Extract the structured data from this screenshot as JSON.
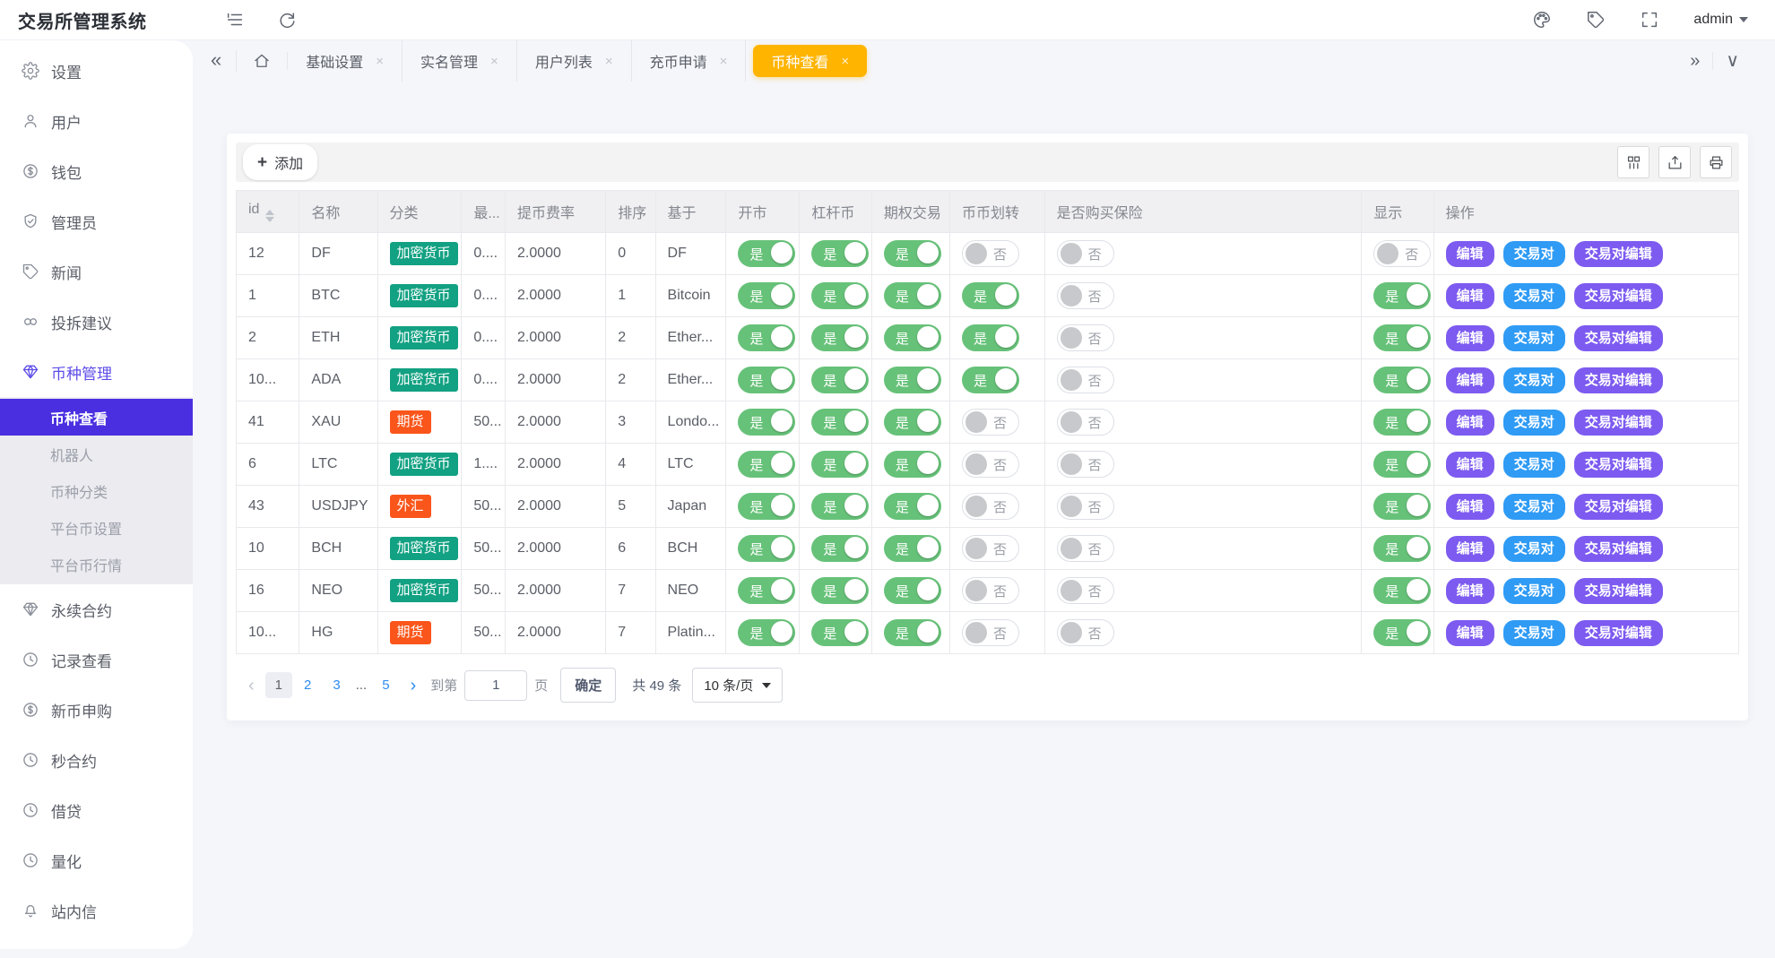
{
  "topbar": {
    "title": "交易所管理系统",
    "user": "admin"
  },
  "glyphs": {
    "double_left": "«",
    "double_right": "»",
    "chevron_down": "∨",
    "close": "×",
    "plus": "+"
  },
  "tabs": {
    "items": [
      {
        "label": "基础设置",
        "active": false
      },
      {
        "label": "实名管理",
        "active": false
      },
      {
        "label": "用户列表",
        "active": false
      },
      {
        "label": "充币申请",
        "active": false
      },
      {
        "label": "币种查看",
        "active": true
      }
    ],
    "active_color": "#ffb400"
  },
  "sidebar": {
    "items": [
      {
        "label": "设置",
        "icon": "gear"
      },
      {
        "label": "用户",
        "icon": "user"
      },
      {
        "label": "钱包",
        "icon": "coin"
      },
      {
        "label": "管理员",
        "icon": "shield"
      },
      {
        "label": "新闻",
        "icon": "tag"
      },
      {
        "label": "投拆建议",
        "icon": "link"
      },
      {
        "label": "币种管理",
        "icon": "gem",
        "active": true,
        "children": [
          {
            "label": "币种查看",
            "active": true
          },
          {
            "label": "机器人",
            "active": false
          },
          {
            "label": "币种分类",
            "active": false
          },
          {
            "label": "平台币设置",
            "active": false
          },
          {
            "label": "平台币行情",
            "active": false
          }
        ]
      },
      {
        "label": "永续合约",
        "icon": "gem"
      },
      {
        "label": "记录查看",
        "icon": "clock"
      },
      {
        "label": "新币申购",
        "icon": "coin"
      },
      {
        "label": "秒合约",
        "icon": "clock"
      },
      {
        "label": "借贷",
        "icon": "clock"
      },
      {
        "label": "量化",
        "icon": "clock"
      },
      {
        "label": "站内信",
        "icon": "bell"
      }
    ],
    "active_bg": "#4a2fe0",
    "active_text": "#5d4ce8"
  },
  "toolbar": {
    "add_label": "添加",
    "add_icon": "+"
  },
  "table": {
    "toggle_on": "是",
    "toggle_off": "否",
    "toggle_on_color": "#67c279",
    "badge_colors": {
      "teal": "#12a182",
      "orange": "#fa551a"
    },
    "columns": [
      {
        "key": "id",
        "label": "id",
        "width": 4.2,
        "sortable": true
      },
      {
        "key": "name",
        "label": "名称",
        "width": 5.2
      },
      {
        "key": "category",
        "label": "分类",
        "width": 5.6,
        "type": "badge"
      },
      {
        "key": "min",
        "label": "最...",
        "width": 2.9
      },
      {
        "key": "fee",
        "label": "提币费率",
        "width": 6.7
      },
      {
        "key": "sort",
        "label": "排序",
        "width": 3.3
      },
      {
        "key": "base",
        "label": "基于",
        "width": 4.7
      },
      {
        "key": "open",
        "label": "开市",
        "width": 4.9,
        "type": "toggle"
      },
      {
        "key": "lever",
        "label": "杠杆币",
        "width": 4.8,
        "type": "toggle"
      },
      {
        "key": "option",
        "label": "期权交易",
        "width": 5.2,
        "type": "toggle"
      },
      {
        "key": "transfer",
        "label": "币币划转",
        "width": 6.3,
        "type": "toggle"
      },
      {
        "key": "insurance",
        "label": "是否购买保险",
        "width": 21.1,
        "type": "toggle"
      },
      {
        "key": "show",
        "label": "显示",
        "width": 4.8,
        "type": "toggle"
      },
      {
        "key": "actions",
        "label": "操作",
        "width": 20.3,
        "type": "actions"
      }
    ],
    "actions": [
      {
        "label": "编辑",
        "color": "purple",
        "name": "edit-button",
        "hex": "#7d5bf0"
      },
      {
        "label": "交易对",
        "color": "blue",
        "name": "trade-pair-button",
        "hex": "#2f9bf5"
      },
      {
        "label": "交易对编辑",
        "color": "purple",
        "name": "trade-pair-edit-button",
        "hex": "#7d5bf0"
      }
    ],
    "rows": [
      {
        "id": "12",
        "name": "DF",
        "category": "加密货币",
        "category_color": "teal",
        "min": "0....",
        "fee": "2.0000",
        "sort": "0",
        "base": "DF",
        "open": true,
        "lever": true,
        "option": true,
        "transfer": false,
        "insurance": false,
        "show": false
      },
      {
        "id": "1",
        "name": "BTC",
        "category": "加密货币",
        "category_color": "teal",
        "min": "0....",
        "fee": "2.0000",
        "sort": "1",
        "base": "Bitcoin",
        "open": true,
        "lever": true,
        "option": true,
        "transfer": true,
        "insurance": false,
        "show": true
      },
      {
        "id": "2",
        "name": "ETH",
        "category": "加密货币",
        "category_color": "teal",
        "min": "0....",
        "fee": "2.0000",
        "sort": "2",
        "base": "Ether...",
        "open": true,
        "lever": true,
        "option": true,
        "transfer": true,
        "insurance": false,
        "show": true
      },
      {
        "id": "10...",
        "name": "ADA",
        "category": "加密货币",
        "category_color": "teal",
        "min": "0....",
        "fee": "2.0000",
        "sort": "2",
        "base": "Ether...",
        "open": true,
        "lever": true,
        "option": true,
        "transfer": true,
        "insurance": false,
        "show": true
      },
      {
        "id": "41",
        "name": "XAU",
        "category": "期货",
        "category_color": "orange",
        "min": "50...",
        "fee": "2.0000",
        "sort": "3",
        "base": "Londo...",
        "open": true,
        "lever": true,
        "option": true,
        "transfer": false,
        "insurance": false,
        "show": true
      },
      {
        "id": "6",
        "name": "LTC",
        "category": "加密货币",
        "category_color": "teal",
        "min": "1....",
        "fee": "2.0000",
        "sort": "4",
        "base": "LTC",
        "open": true,
        "lever": true,
        "option": true,
        "transfer": false,
        "insurance": false,
        "show": true
      },
      {
        "id": "43",
        "name": "USDJPY",
        "category": "外汇",
        "category_color": "orange",
        "min": "50...",
        "fee": "2.0000",
        "sort": "5",
        "base": "Japan",
        "open": true,
        "lever": true,
        "option": true,
        "transfer": false,
        "insurance": false,
        "show": true
      },
      {
        "id": "10",
        "name": "BCH",
        "category": "加密货币",
        "category_color": "teal",
        "min": "50...",
        "fee": "2.0000",
        "sort": "6",
        "base": "BCH",
        "open": true,
        "lever": true,
        "option": true,
        "transfer": false,
        "insurance": false,
        "show": true
      },
      {
        "id": "16",
        "name": "NEO",
        "category": "加密货币",
        "category_color": "teal",
        "min": "50...",
        "fee": "2.0000",
        "sort": "7",
        "base": "NEO",
        "open": true,
        "lever": true,
        "option": true,
        "transfer": false,
        "insurance": false,
        "show": true
      },
      {
        "id": "10...",
        "name": "HG",
        "category": "期货",
        "category_color": "orange",
        "min": "50...",
        "fee": "2.0000",
        "sort": "7",
        "base": "Platin...",
        "open": true,
        "lever": true,
        "option": true,
        "transfer": false,
        "insurance": false,
        "show": true
      }
    ]
  },
  "pagination": {
    "prev": "‹",
    "next": "›",
    "pages": [
      "1",
      "2",
      "3",
      "...",
      "5"
    ],
    "active_page": "1",
    "goto_label": "到第",
    "goto_value": "1",
    "page_label": "页",
    "confirm_label": "确定",
    "total_label": "共 49 条",
    "size_label": "10 条/页"
  }
}
